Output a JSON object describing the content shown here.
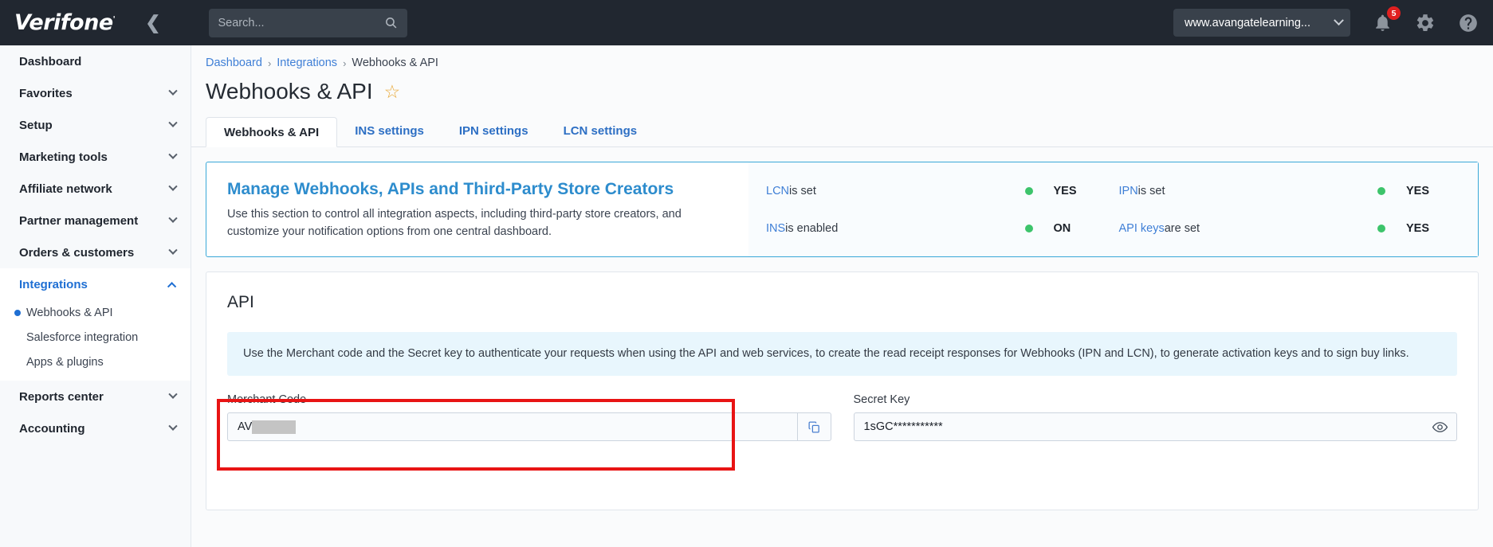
{
  "header": {
    "logo_text": "Verifone",
    "logo_mark": "'",
    "collapse_icon": "chevron-left-icon",
    "search": {
      "placeholder": "Search...",
      "value": "",
      "icon": "search-icon"
    },
    "account": {
      "label": "www.avangatelearning...",
      "icon": "chevron-down-icon"
    },
    "notifications": {
      "icon": "bell-icon",
      "count": "5",
      "badge_color": "#e02020"
    },
    "settings": {
      "icon": "gear-icon"
    },
    "help": {
      "icon": "help-circle-icon"
    }
  },
  "sidebar": {
    "items": [
      {
        "label": "Dashboard",
        "expandable": false
      },
      {
        "label": "Favorites",
        "expandable": true
      },
      {
        "label": "Setup",
        "expandable": true
      },
      {
        "label": "Marketing tools",
        "expandable": true
      },
      {
        "label": "Affiliate network",
        "expandable": true
      },
      {
        "label": "Partner management",
        "expandable": true
      },
      {
        "label": "Orders & customers",
        "expandable": true
      },
      {
        "label": "Integrations",
        "expandable": true,
        "expanded": true,
        "active": true
      },
      {
        "label": "Reports center",
        "expandable": true
      },
      {
        "label": "Accounting",
        "expandable": true
      }
    ],
    "integrations_children": [
      {
        "label": "Webhooks & API",
        "selected": true
      },
      {
        "label": "Salesforce integration",
        "selected": false
      },
      {
        "label": "Apps & plugins",
        "selected": false
      }
    ],
    "active_color": "#1f6fd3"
  },
  "breadcrumb": {
    "items": [
      "Dashboard",
      "Integrations",
      "Webhooks & API"
    ],
    "separator": "›"
  },
  "page": {
    "title": "Webhooks & API",
    "favorite_icon": "star-outline-icon"
  },
  "tabs": [
    {
      "label": "Webhooks & API",
      "active": true
    },
    {
      "label": "INS settings",
      "active": false
    },
    {
      "label": "IPN settings",
      "active": false
    },
    {
      "label": "LCN settings",
      "active": false
    }
  ],
  "info_panel": {
    "title": "Manage Webhooks, APIs and Third-Party Store Creators",
    "description": "Use this section to control all integration aspects, including third-party store creators, and customize your notification options from one central dashboard.",
    "border_color": "#3aa8d8",
    "statuses": [
      {
        "link": "LCN",
        "label": " is set",
        "dot_color": "#3dc46b",
        "value": "YES"
      },
      {
        "link": "IPN",
        "label": " is set",
        "dot_color": "#3dc46b",
        "value": "YES"
      },
      {
        "link": "INS",
        "label": " is enabled",
        "dot_color": "#3dc46b",
        "value": "ON"
      },
      {
        "link": "API keys",
        "label": " are set",
        "dot_color": "#3dc46b",
        "value": "YES"
      }
    ]
  },
  "api_section": {
    "heading": "API",
    "note": "Use the Merchant code and the Secret key to authenticate your requests when using the API and web services, to create the read receipt responses for Webhooks (IPN and LCN), to generate activation keys and to sign buy links.",
    "merchant_code": {
      "label": "Merchant Code",
      "value": "AV",
      "redacted": true,
      "copy_icon": "copy-icon",
      "highlight_color": "#e81414"
    },
    "secret_key": {
      "label": "Secret Key",
      "value": "1sGC***********",
      "reveal_icon": "eye-icon"
    }
  }
}
